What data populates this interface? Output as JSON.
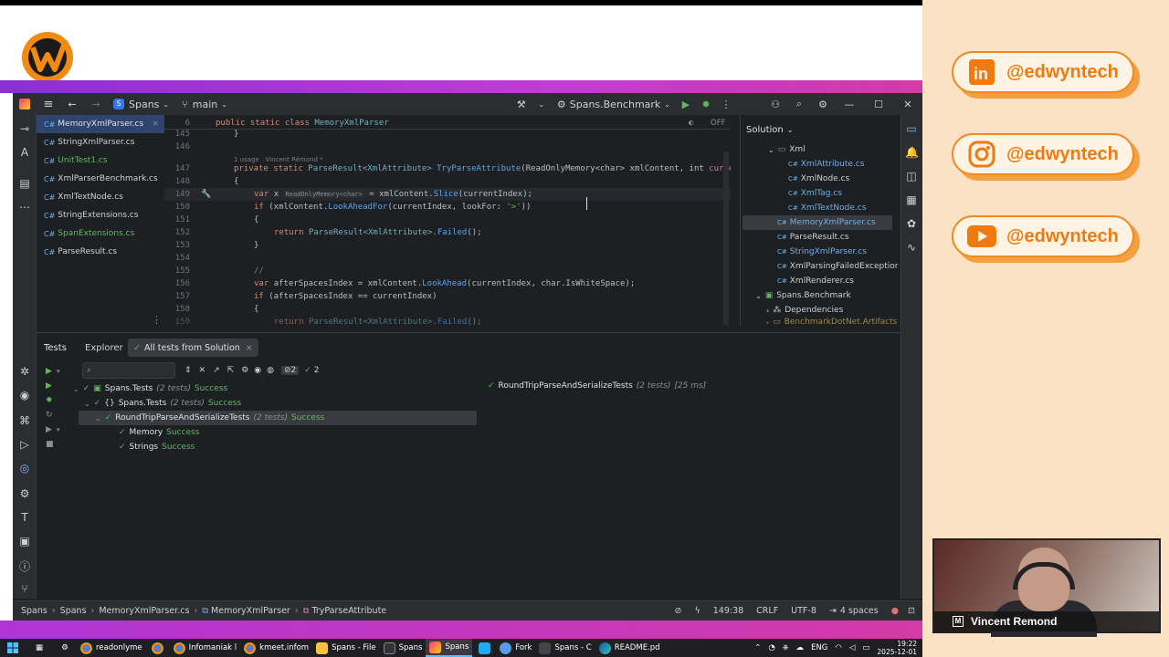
{
  "branding": {
    "linkedin": "@edwyntech",
    "instagram": "@edwyntech",
    "youtube": "@edwyntech",
    "presenter": "Vincent Remond"
  },
  "ide": {
    "project": "Spans",
    "branch": "main",
    "run_config": "Spans.Benchmark",
    "open_files": [
      "MemoryXmlParser.cs",
      "StringXmlParser.cs",
      "UnitTest1.cs",
      "XmlParserBenchmark.cs",
      "XmlTextNode.cs",
      "StringExtensions.cs",
      "SpanExtensions.cs",
      "ParseResult.cs"
    ],
    "editor": {
      "off_label": "OFF",
      "usage": "1 usage",
      "author": "Vincent Rémond *",
      "hint": "ReadOnlyMemory<char>",
      "lines": [
        "6",
        "145",
        "146",
        "147",
        "148",
        "149",
        "150",
        "151",
        "152",
        "153",
        "154",
        "155",
        "156",
        "157",
        "158",
        "159"
      ],
      "l6a": "public static class ",
      "l6b": "MemoryXmlParser",
      "l145": "}",
      "l147a": "private static ",
      "l147b": "ParseResult<XmlAttribute> ",
      "l147c": "TryParseAttribute",
      "l147d": "(ReadOnlyMemory<char> xmlContent, int ",
      "l147e": "curren",
      "l148": "{",
      "l149a": "var ",
      "l149b": "x ",
      "l149c": " = xmlContent.",
      "l149d": "Slice",
      "l149e": "(currentIndex);",
      "l150a": "if ",
      "l150b": "(xmlContent.",
      "l150c": "LookAheadFor",
      "l150d": "(currentIndex, lookFor: ",
      "l150e": "'>'",
      "l150f": "))",
      "l151": "{",
      "l152a": "return ",
      "l152b": "ParseResult<XmlAttribute>.",
      "l152c": "Failed",
      "l152d": "();",
      "l153": "}",
      "l155": "//",
      "l156a": "var ",
      "l156b": "afterSpacesIndex = xmlContent.",
      "l156c": "LookAhead",
      "l156d": "(currentIndex, char.IsWhiteSpace);",
      "l157a": "if ",
      "l157b": "(afterSpacesIndex == currentIndex)",
      "l158": "{",
      "l159a": "return ",
      "l159b": "ParseResult<XmlAttribute>.",
      "l159c": "Failed",
      "l159d": "();"
    },
    "solution": {
      "title": "Solution",
      "items": [
        "Xml",
        "XmlAttribute.cs",
        "XmlNode.cs",
        "XmlTag.cs",
        "XmlTextNode.cs",
        "MemoryXmlParser.cs",
        "ParseResult.cs",
        "StringXmlParser.cs",
        "XmlParsingFailedException.cs",
        "XmlRenderer.cs",
        "Spans.Benchmark",
        "Dependencies",
        "BenchmarkDotNet.Artifacts"
      ]
    },
    "tests": {
      "tab_tests": "Tests",
      "tab_explorer": "Explorer",
      "tab_all": "All tests from Solution",
      "count_ignored": "2",
      "count_passed": "2",
      "root": "Spans.Tests",
      "root_count": "(2 tests)",
      "success": "Success",
      "ns": "Spans.Tests",
      "ns_count": "(2 tests)",
      "cls": "RoundTripParseAndSerializeTests",
      "cls_count": "(2 tests)",
      "t1": "Memory",
      "t2": "Strings",
      "detail": "RoundTripParseAndSerializeTests",
      "detail_count": "(2 tests)",
      "detail_time": "[25 ms]"
    },
    "status": {
      "crumbs": [
        "Spans",
        "Spans",
        "MemoryXmlParser.cs",
        "MemoryXmlParser",
        "TryParseAttribute"
      ],
      "pos": "149:38",
      "eol": "CRLF",
      "enc": "UTF-8",
      "indent": "4 spaces"
    }
  },
  "taskbar": {
    "items": [
      "readonlyme",
      "Infomaniak l",
      "kmeet.infom",
      "Spans - File",
      "Spans",
      "Spans",
      "Fork",
      "Spans - C",
      "README.pd"
    ],
    "lang": "ENG",
    "time": "19:22",
    "date": "2025-12-01"
  },
  "colors": {
    "accent": "#f07a10",
    "ide_bg": "#1e1f22",
    "success": "#5fb865"
  }
}
